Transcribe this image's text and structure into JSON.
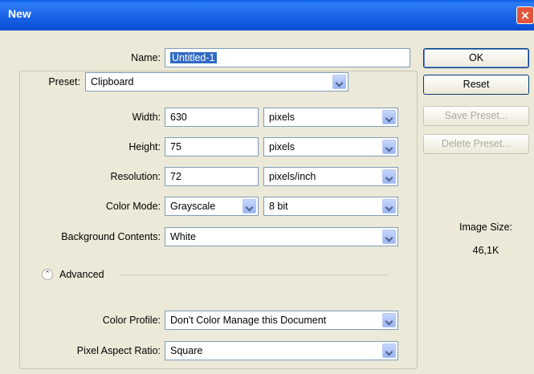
{
  "window": {
    "title": "New",
    "close_symbol": "×"
  },
  "name": {
    "label": "Name:",
    "value": "Untitled-1"
  },
  "preset": {
    "label": "Preset:",
    "value": "Clipboard"
  },
  "width": {
    "label": "Width:",
    "value": "630",
    "unit": "pixels"
  },
  "height": {
    "label": "Height:",
    "value": "75",
    "unit": "pixels"
  },
  "resolution": {
    "label": "Resolution:",
    "value": "72",
    "unit": "pixels/inch"
  },
  "color_mode": {
    "label": "Color Mode:",
    "value": "Grayscale",
    "depth": "8 bit"
  },
  "background": {
    "label": "Background Contents:",
    "value": "White"
  },
  "advanced": {
    "label": "Advanced",
    "icon_glyph": "⌃"
  },
  "color_profile": {
    "label": "Color Profile:",
    "value": "Don't Color Manage this Document"
  },
  "pixel_aspect": {
    "label": "Pixel Aspect Ratio:",
    "value": "Square"
  },
  "buttons": {
    "ok": "OK",
    "reset": "Reset",
    "save_preset": "Save Preset...",
    "delete_preset": "Delete Preset..."
  },
  "image_size": {
    "label": "Image Size:",
    "value": "46,1K"
  },
  "colors": {
    "title_bar": "#1a62e5",
    "dialog_bg": "#ece9d8",
    "selection": "#316ac5",
    "close_button": "#e2553a"
  }
}
